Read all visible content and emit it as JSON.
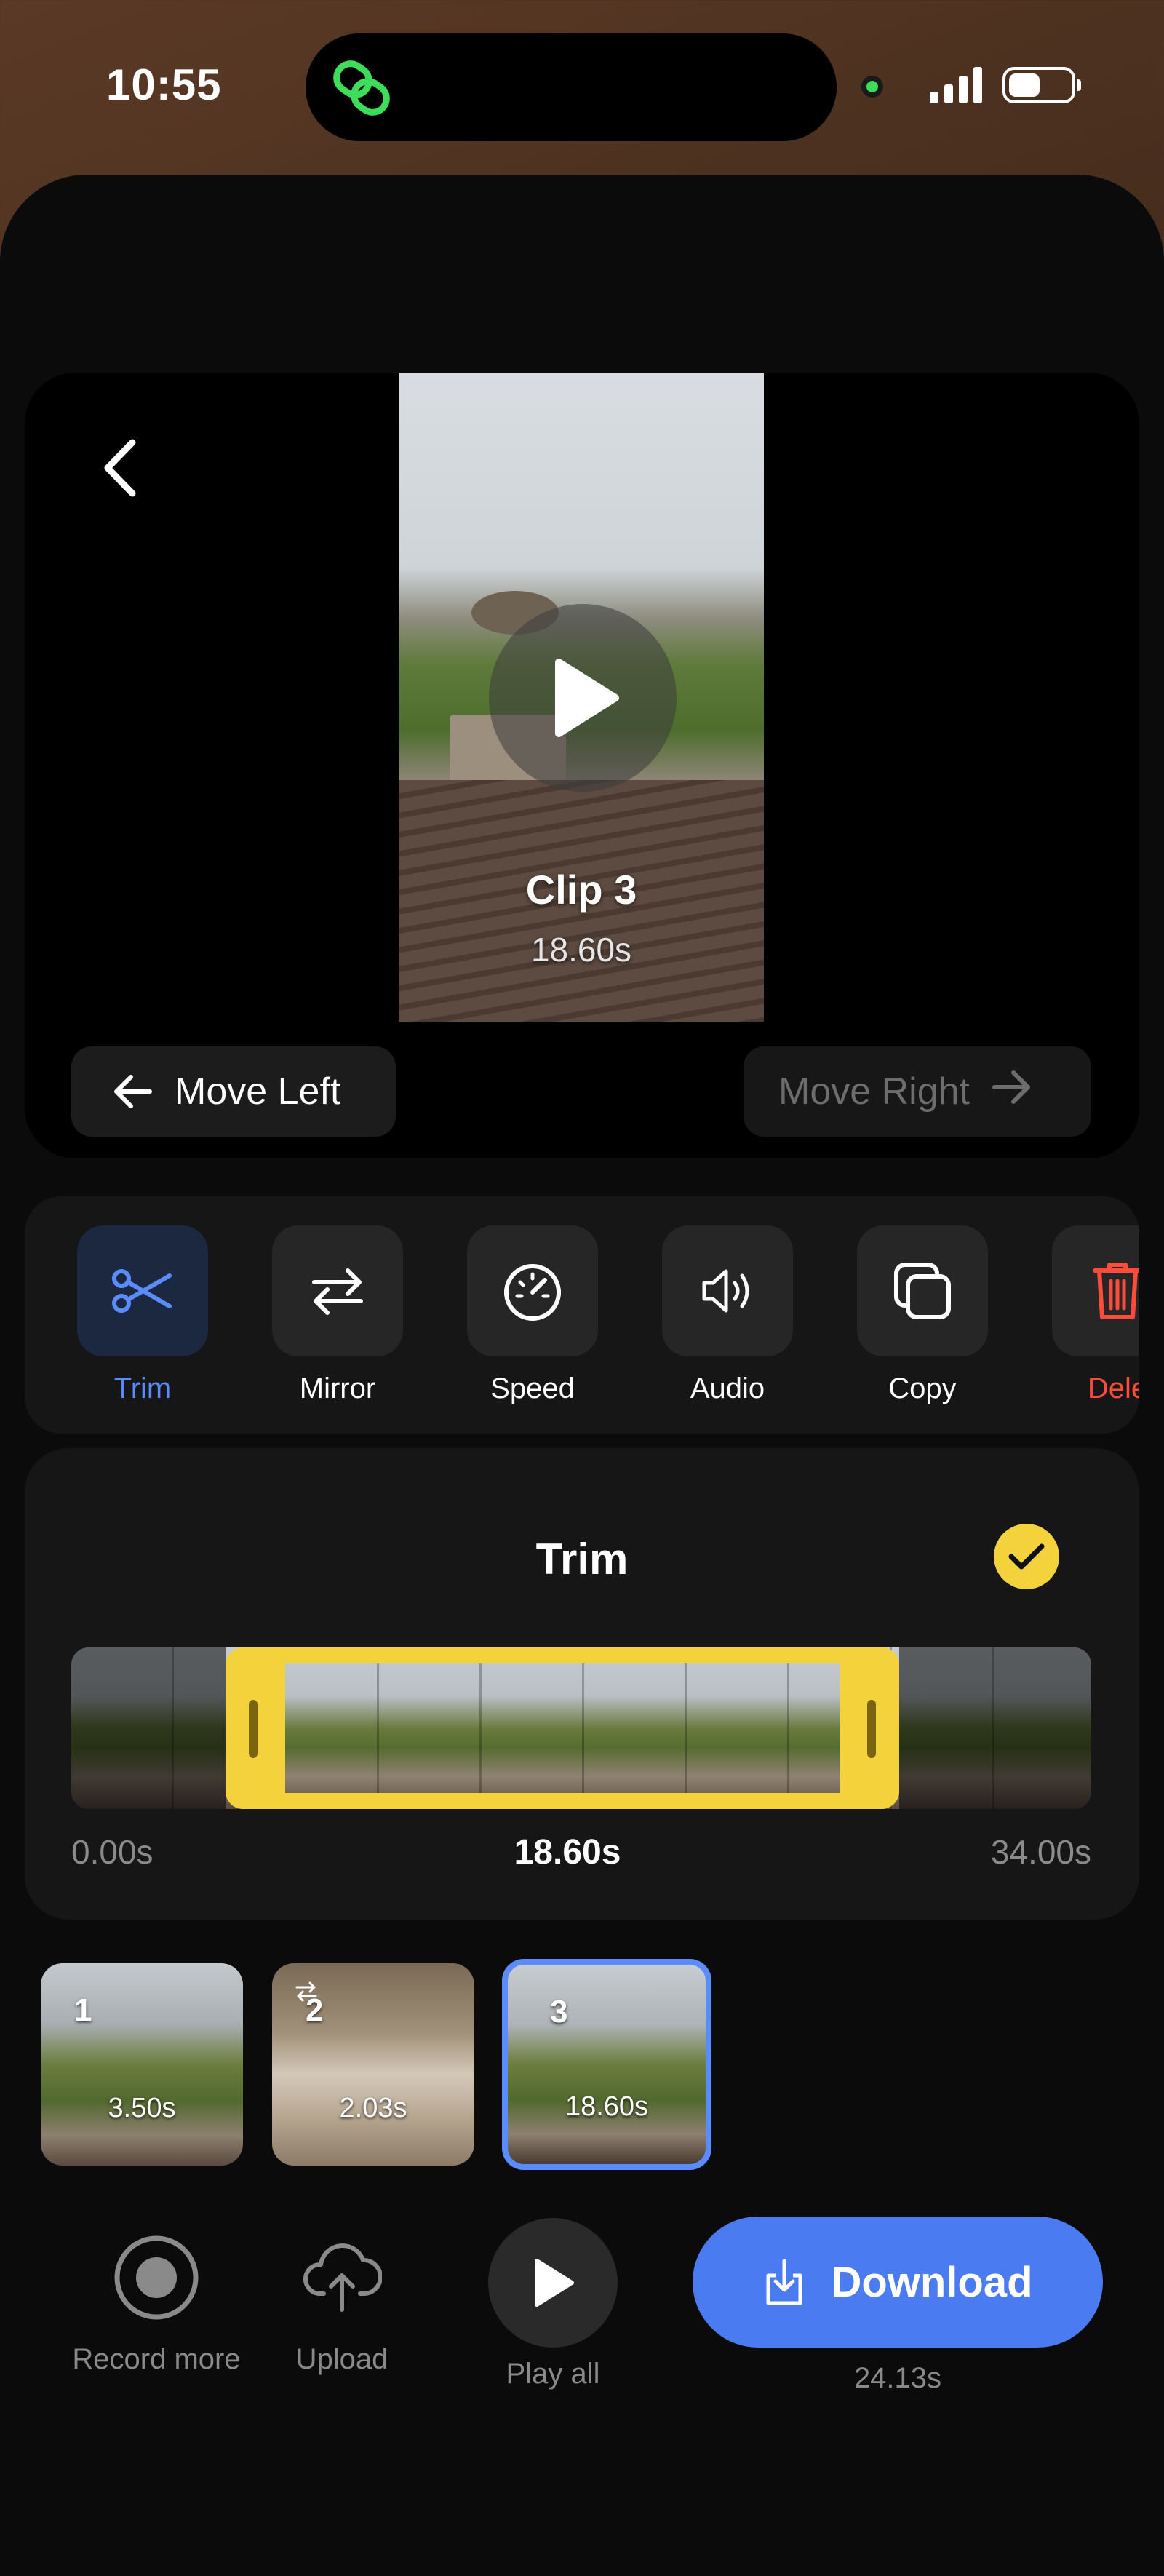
{
  "status_bar": {
    "time": "10:55"
  },
  "preview": {
    "clip_title": "Clip 3",
    "clip_duration": "18.60s",
    "move_left_label": "Move Left",
    "move_right_label": "Move Right"
  },
  "tools": [
    {
      "label": "Trim",
      "icon": "scissors-icon",
      "active": true
    },
    {
      "label": "Mirror",
      "icon": "swap-arrows-icon"
    },
    {
      "label": "Speed",
      "icon": "speedometer-icon"
    },
    {
      "label": "Audio",
      "icon": "speaker-icon"
    },
    {
      "label": "Copy",
      "icon": "copy-icon"
    },
    {
      "label": "Dele",
      "icon": "trash-icon"
    }
  ],
  "trim": {
    "title": "Trim",
    "start": "0.00s",
    "selected": "18.60s",
    "end": "34.00s"
  },
  "clips": [
    {
      "number": "1",
      "duration": "3.50s"
    },
    {
      "number": "2",
      "duration": "2.03s",
      "mirrored": true
    },
    {
      "number": "3",
      "duration": "18.60s",
      "selected": true
    }
  ],
  "actions": {
    "record_label": "Record more",
    "upload_label": "Upload",
    "play_all_label": "Play all",
    "download_label": "Download",
    "total_duration": "24.13s"
  },
  "colors": {
    "accent": "#4a7bf0",
    "trim": "#f4d23c",
    "delete": "#ff4b3a",
    "active_tool": "#5b8cff"
  }
}
